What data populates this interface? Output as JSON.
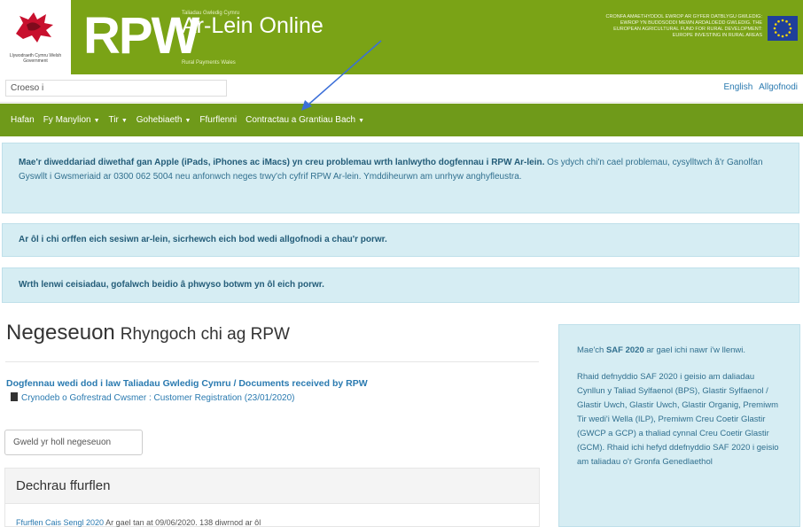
{
  "header": {
    "gov_name": "Llywodraeth Cymru Welsh Government",
    "logo": "RPW",
    "product_small": "Taliadau Gwledig Cymru",
    "product_title": "Ar-Lein Online",
    "product_sub": "Rural Payments Wales",
    "eu_text": "Cronfa Amaethyddol Ewrop ar gyfer Datblygu Gwledig: Ewrop yn buddsoddi mewn ardaloedd gwledig. The European Agricultural Fund for Rural Development: Europe investing in rural areas",
    "eu_flag_icon": "eu-flag-icon",
    "dragon_icon": "welsh-dragon-icon"
  },
  "lang_bar": {
    "welcome": "Croeso i",
    "english": "English",
    "logout": "Allgofnodi"
  },
  "nav": {
    "items": [
      {
        "label": "Hafan",
        "dropdown": false
      },
      {
        "label": "Fy Manylion",
        "dropdown": true
      },
      {
        "label": "Tir",
        "dropdown": true
      },
      {
        "label": "Gohebiaeth",
        "dropdown": true
      },
      {
        "label": "Ffurflenni",
        "dropdown": false
      },
      {
        "label": "Contractau a Grantiau Bach",
        "dropdown": true
      }
    ]
  },
  "alerts": {
    "a1_bold": "Mae'r diweddariad diwethaf gan Apple (iPads, iPhones ac iMacs) yn creu problemau wrth lanlwytho dogfennau i RPW Ar-lein.",
    "a1_text": " Os ydych chi'n cael problemau, cysylltwch â'r Ganolfan Gyswllt i Gwsmeriaid ar 0300 062 5004 neu anfonwch neges trwy'ch cyfrif RPW Ar-lein. Ymddiheurwn am unrhyw anghyfleustra.",
    "a2": "Ar ôl i chi orffen eich sesiwn ar-lein, sicrhewch eich bod wedi allgofnodi a chau'r porwr.",
    "a3": "Wrth lenwi ceisiadau, gofalwch beidio â phwyso botwm yn ôl eich porwr."
  },
  "messages": {
    "title": "Negeseuon",
    "subtitle": "Rhyngoch chi ag RPW",
    "doc_link": "Dogfennau wedi dod i law Taliadau Gwledig Cymru / Documents received by RPW",
    "doc_item": "Crynodeb o Gofrestrad Cwsmer : Customer Registration (23/01/2020)",
    "all_button": "Gweld yr holl negeseuon"
  },
  "forms": {
    "title": "Dechrau ffurflen",
    "item_link": "Ffurflen Cais Sengl 2020",
    "item_text": " Ar gael tan at 09/06/2020. 138 diwrnod ar ôl"
  },
  "sidebar": {
    "p1_pre": "Mae'ch ",
    "p1_bold": "SAF 2020",
    "p1_post": " ar gael ichi nawr i'w llenwi.",
    "p2": "Rhaid defnyddio SAF 2020 i geisio am daliadau Cynllun y Taliad Sylfaenol (BPS), Glastir Sylfaenol / Glastir Uwch, Glastir Uwch, Glastir Organig, Premiwm Tir wedi'i Wella (ILP), Premiwm Creu Coetir Glastir (GWCP a GCP) a thaliad cynnal Creu Coetir Glastir (GCM). Rhaid ichi hefyd ddefnyddio SAF 2020 i geisio am taliadau o'r Gronfa Genedlaethol"
  },
  "colors": {
    "brand_green": "#7aa316",
    "nav_green": "#6f9a1a",
    "info_bg": "#d6edf3",
    "link_blue": "#2a7ab0",
    "arrow_blue": "#3b6fd8"
  }
}
